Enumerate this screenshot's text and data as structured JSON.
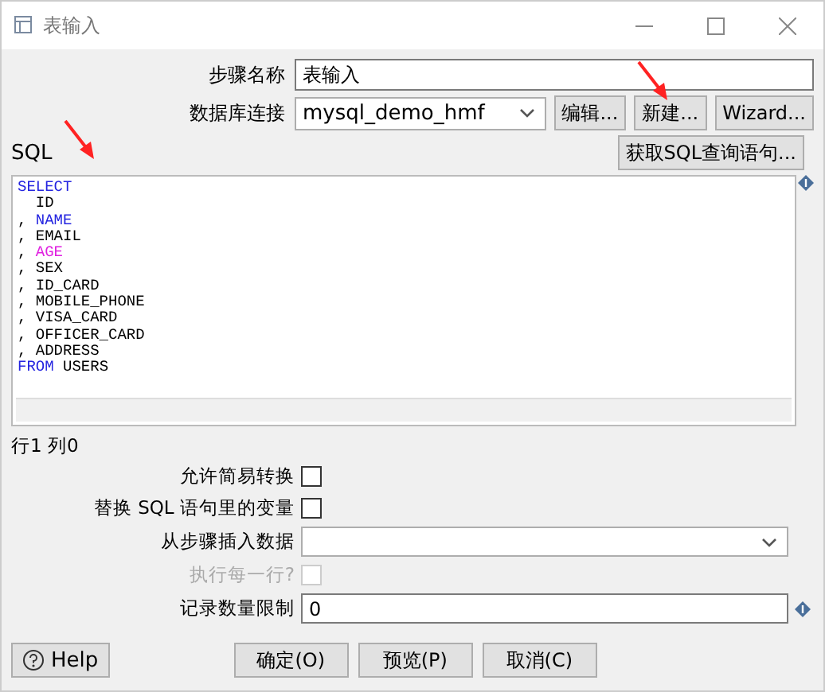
{
  "window": {
    "title": "表输入"
  },
  "step_name": {
    "label": "步骤名称",
    "value": "表输入"
  },
  "connection": {
    "label": "数据库连接",
    "value": "mysql_demo_hmf",
    "buttons": [
      "编辑...",
      "新建...",
      "Wizard..."
    ]
  },
  "sql": {
    "label": "SQL",
    "get_button": "获取SQL查询语句...",
    "lines": [
      [
        {
          "text": "SELECT",
          "kind": "keyword"
        }
      ],
      [
        {
          "text": "  ID",
          "kind": "plain"
        }
      ],
      [
        {
          "text": ", ",
          "kind": "plain"
        },
        {
          "text": "NAME",
          "kind": "keyword"
        }
      ],
      [
        {
          "text": ", EMAIL",
          "kind": "plain"
        }
      ],
      [
        {
          "text": ", ",
          "kind": "plain"
        },
        {
          "text": "AGE",
          "kind": "function"
        }
      ],
      [
        {
          "text": ", SEX",
          "kind": "plain"
        }
      ],
      [
        {
          "text": ", ID_CARD",
          "kind": "plain"
        }
      ],
      [
        {
          "text": ", MOBILE_PHONE",
          "kind": "plain"
        }
      ],
      [
        {
          "text": ", VISA_CARD",
          "kind": "plain"
        }
      ],
      [
        {
          "text": ", OFFICER_CARD",
          "kind": "plain"
        }
      ],
      [
        {
          "text": ", ADDRESS",
          "kind": "plain"
        }
      ],
      [
        {
          "text": "FROM",
          "kind": "keyword"
        },
        {
          "text": " USERS",
          "kind": "plain"
        }
      ]
    ]
  },
  "cursor_position": "行1 列0",
  "options": [
    {
      "kind": "checkbox",
      "label": "允许简易转换",
      "checked": false,
      "disabled": false
    },
    {
      "kind": "checkbox",
      "label": "替换 SQL 语句里的变量",
      "checked": false,
      "disabled": false
    },
    {
      "kind": "dropdown",
      "label": "从步骤插入数据"
    },
    {
      "kind": "checkbox",
      "label": "执行每一行?",
      "checked": false,
      "disabled": true
    },
    {
      "kind": "text",
      "label": "记录数量限制",
      "value": "0"
    }
  ],
  "help_button": "Help",
  "buttons": [
    "确定(O)",
    "预览(P)",
    "取消(C)"
  ]
}
